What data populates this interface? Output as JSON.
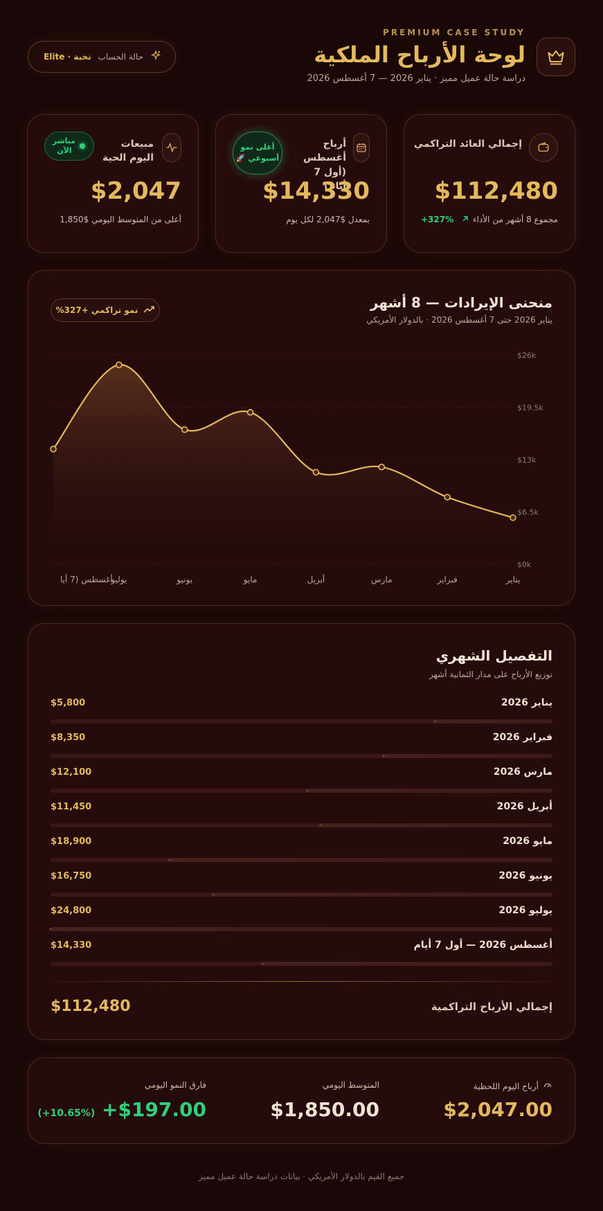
{
  "header": {
    "eyebrow": "PREMIUM CASE STUDY",
    "title": "لوحة الأرباح الملكية",
    "subtitle": "دراسة حالة عميل مميز · يناير 2026 — 7 أغسطس 2026",
    "status_label": "حالة الحساب",
    "status_value": "نخبة · Elite",
    "icons": {
      "crown": "crown-icon",
      "sparkle": "sparkle-icon"
    }
  },
  "kpis": {
    "cumulative": {
      "label": "إجمالي العائد التراكمي",
      "value": "$112,480",
      "note": "مجموع 8 أشهر من الأداء",
      "growth": "+327%",
      "icon": "wallet-icon"
    },
    "august": {
      "label": "أرباح أغسطس (أول 7 أيام)",
      "value": "$14,330",
      "note": "بمعدل $2,047 لكل يوم",
      "badge": "أعلى نمو أسبوعي 🚀",
      "icon": "calendar-icon"
    },
    "live": {
      "label": "مبيعات اليوم الحية",
      "value": "$2,047",
      "note": "أعلى من المتوسط اليومي $1,850",
      "badge": "مباشر الآن",
      "icon": "pulse-icon"
    }
  },
  "chart": {
    "title": "منحنى الإيرادات — 8 أشهر",
    "subtitle": "يناير 2026 حتى 7 أغسطس 2026 · بالدولار الأمريكي",
    "chip": "نمو تراكمي +327%"
  },
  "chart_data": {
    "type": "area",
    "categories": [
      "يناير",
      "فبراير",
      "مارس",
      "أبريل",
      "مايو",
      "يونيو",
      "يوليو",
      "أغسطس (7 أيا"
    ],
    "values": [
      5800,
      8350,
      12100,
      11450,
      18900,
      16750,
      24800,
      14330
    ],
    "y_ticks": [
      "$0k",
      "$6.5k",
      "$13k",
      "$19.5k",
      "$26k"
    ],
    "ylim": [
      0,
      26000
    ],
    "grid": true,
    "x_direction": "right-to-left",
    "colors": {
      "line": "#e4b95e",
      "area_top": "#5c3520",
      "area_bottom": "#260b0c"
    }
  },
  "breakdown": {
    "title": "التفصيل الشهري",
    "subtitle": "توزيع الأرباح على مدار الثمانية أشهر",
    "rows": [
      {
        "label": "يناير 2026",
        "value": "$5,800",
        "amount": 5800
      },
      {
        "label": "فبراير 2026",
        "value": "$8,350",
        "amount": 8350
      },
      {
        "label": "مارس 2026",
        "value": "$12,100",
        "amount": 12100
      },
      {
        "label": "أبريل 2026",
        "value": "$11,450",
        "amount": 11450
      },
      {
        "label": "مايو 2026",
        "value": "$18,900",
        "amount": 18900
      },
      {
        "label": "يونيو 2026",
        "value": "$16,750",
        "amount": 16750
      },
      {
        "label": "يوليو 2026",
        "value": "$24,800",
        "amount": 24800
      },
      {
        "label": "أغسطس 2026 — أول 7 أيام",
        "value": "$14,330",
        "amount": 14330
      }
    ],
    "total_label": "إجمالي الأرباح التراكمية",
    "total_value": "$112,480"
  },
  "stats": {
    "instant": {
      "label": "أرباح اليوم اللحظية",
      "value": "$2,047.00",
      "icon": "gauge-icon"
    },
    "average": {
      "label": "المتوسط اليومي",
      "value": "$1,850.00"
    },
    "diff": {
      "label": "فارق النمو اليومي",
      "value": "+$197.00",
      "percent": "(+10.65%)"
    }
  },
  "footer": "جميع القيم بالدولار الأمريكي · بيانات دراسة حالة عميل مميز",
  "colors": {
    "gold": "#e4b95e",
    "green": "#2fd07a",
    "background": "#1a0708",
    "card": "#260b0c"
  }
}
